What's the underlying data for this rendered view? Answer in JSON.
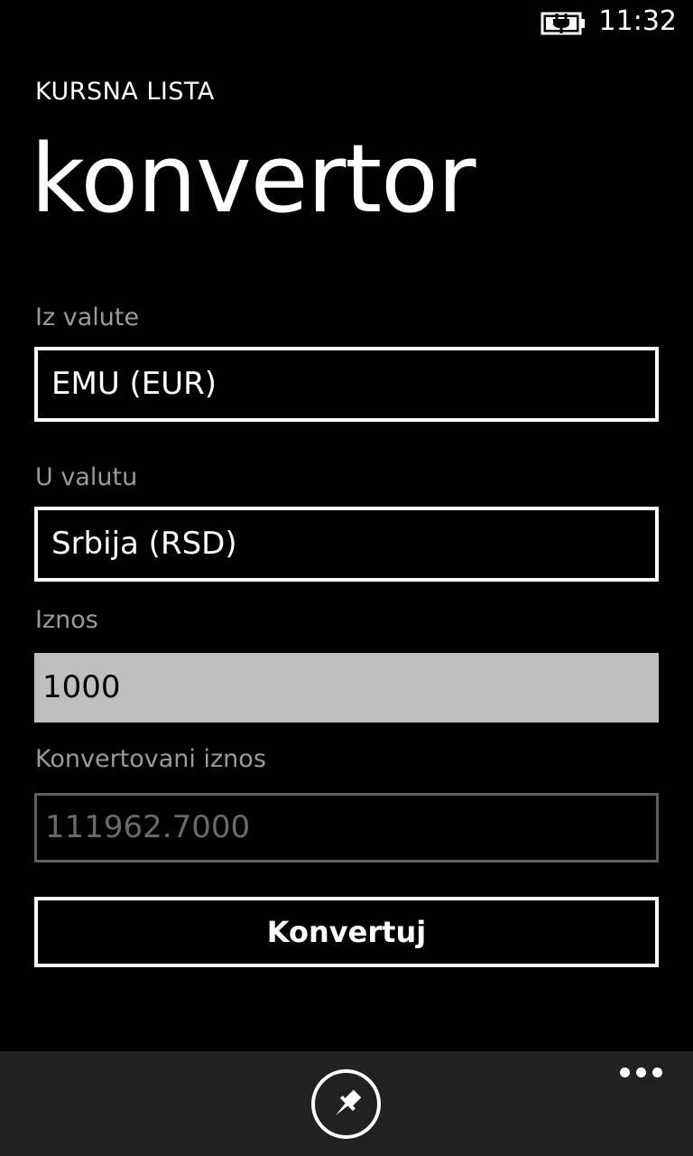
{
  "status_bar": {
    "time": "11:32",
    "battery_icon": "battery-charging-icon"
  },
  "header": {
    "app_title": "KURSNA LISTA",
    "page_title": "konvertor"
  },
  "form": {
    "from_label": "Iz valute",
    "from_value": "EMU (EUR)",
    "to_label": "U valutu",
    "to_value": "Srbija (RSD)",
    "amount_label": "Iznos",
    "amount_value": "1000",
    "converted_label": "Konvertovani iznos",
    "converted_value": "111962.7000",
    "convert_button": "Konvertuj"
  },
  "app_bar": {
    "pin_icon": "pin-icon",
    "more_icon": "more-ellipsis-icon"
  },
  "colors": {
    "background": "#000000",
    "label_gray": "#9a9a9a",
    "input_bg": "#bfbfbf",
    "app_bar_bg": "#212121"
  }
}
